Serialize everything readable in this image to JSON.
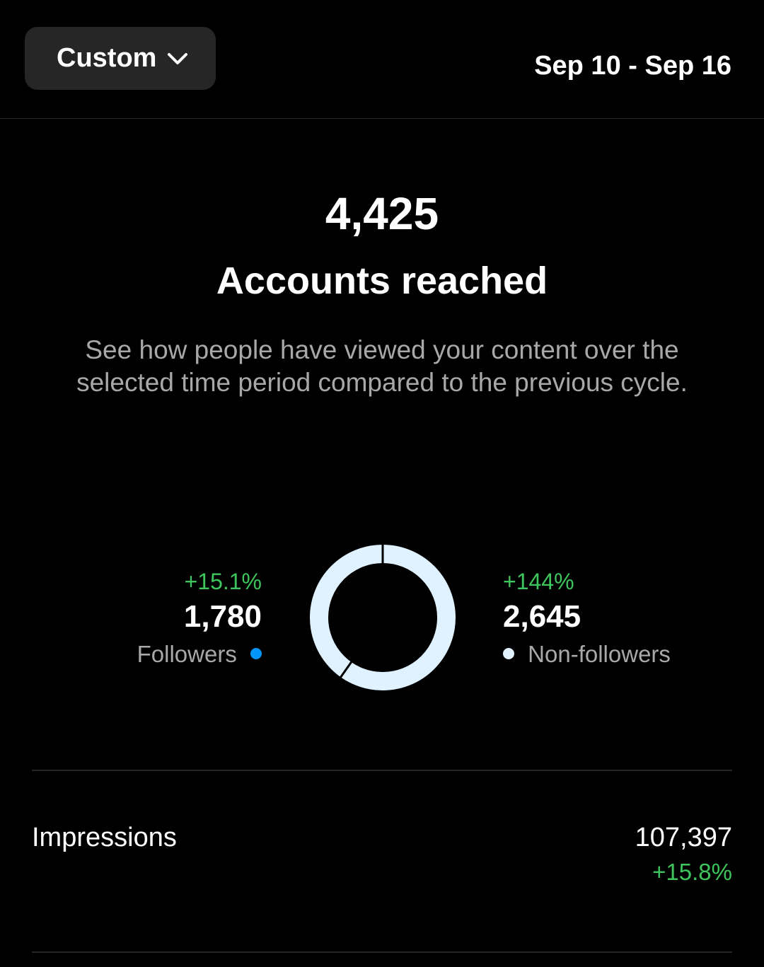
{
  "header": {
    "range_selector_label": "Custom",
    "date_range": "Sep 10 - Sep 16"
  },
  "overview": {
    "total": "4,425",
    "title": "Accounts reached",
    "description": "See how people have viewed your content over the selected time period compared to the previous cycle."
  },
  "breakdown": {
    "followers": {
      "delta": "+15.1%",
      "value": "1,780",
      "label": "Followers",
      "color": "#0095f6"
    },
    "non_followers": {
      "delta": "+144%",
      "value": "2,645",
      "label": "Non-followers",
      "color": "#e0f1ff"
    }
  },
  "metrics": [
    {
      "label": "Impressions",
      "value": "107,397",
      "delta": "+15.8%"
    }
  ],
  "colors": {
    "background": "#000000",
    "positive_delta": "#3ec55d",
    "muted_text": "#a8a8a8",
    "button_background": "#262626"
  },
  "icons": {
    "range_selector": "chevron-down-icon"
  }
}
